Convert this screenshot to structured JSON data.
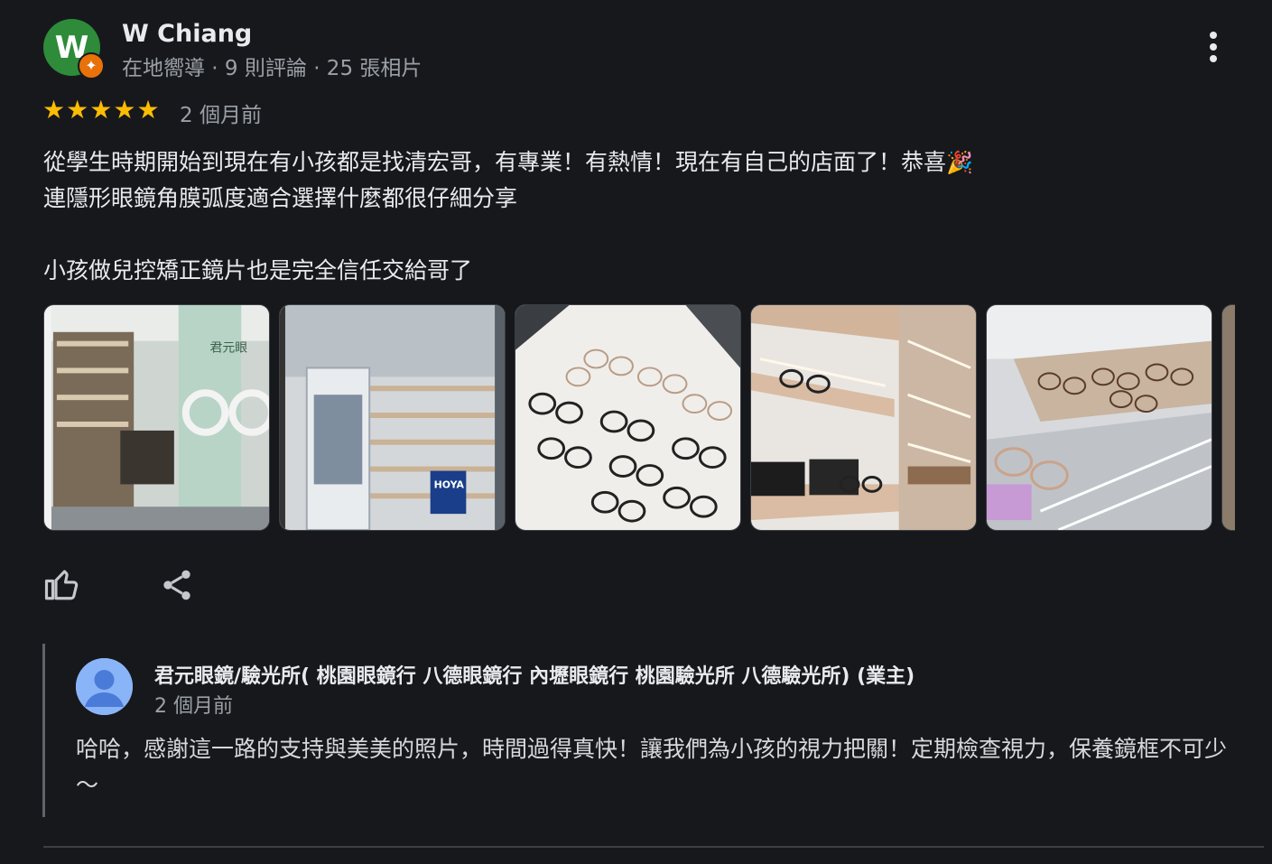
{
  "reviewer": {
    "initial": "W",
    "name": "W Chiang",
    "meta": "在地嚮導 · 9 則評論 · 25 張相片",
    "avatar_color": "#2e8b3a",
    "badge_color": "#e8710a"
  },
  "review": {
    "rating": 5,
    "star_color": "#fbbc04",
    "date": "2 個月前",
    "line1": "從學生時期開始到現在有小孩都是找清宏哥，有專業！有熱情！現在有自己的店面了！恭喜",
    "emoji": "🎉",
    "line2": "連隱形眼鏡角膜弧度適合選擇什麼都很仔細分享",
    "line3": "小孩做兒控矯正鏡片也是完全信任交給哥了"
  },
  "photos": [
    {
      "name": "storefront-photo",
      "sign_text": "君元眼"
    },
    {
      "name": "display-case-photo",
      "sign_text": "HOYA"
    },
    {
      "name": "frames-wall-photo"
    },
    {
      "name": "shelves-photo"
    },
    {
      "name": "display-tray-photo"
    }
  ],
  "actions": {
    "like_icon": "thumbs-up-icon",
    "share_icon": "share-icon",
    "more_icon": "more-vert-icon"
  },
  "owner_reply": {
    "name": "君元眼鏡/驗光所( 桃園眼鏡行 八德眼鏡行 內壢眼鏡行 桃園驗光所 八德驗光所) (業主)",
    "date": "2 個月前",
    "text": "哈哈，感謝這一路的支持與美美的照片，時間過得真快！讓我們為小孩的視力把關！定期檢查視力，保養鏡框不可少～"
  }
}
